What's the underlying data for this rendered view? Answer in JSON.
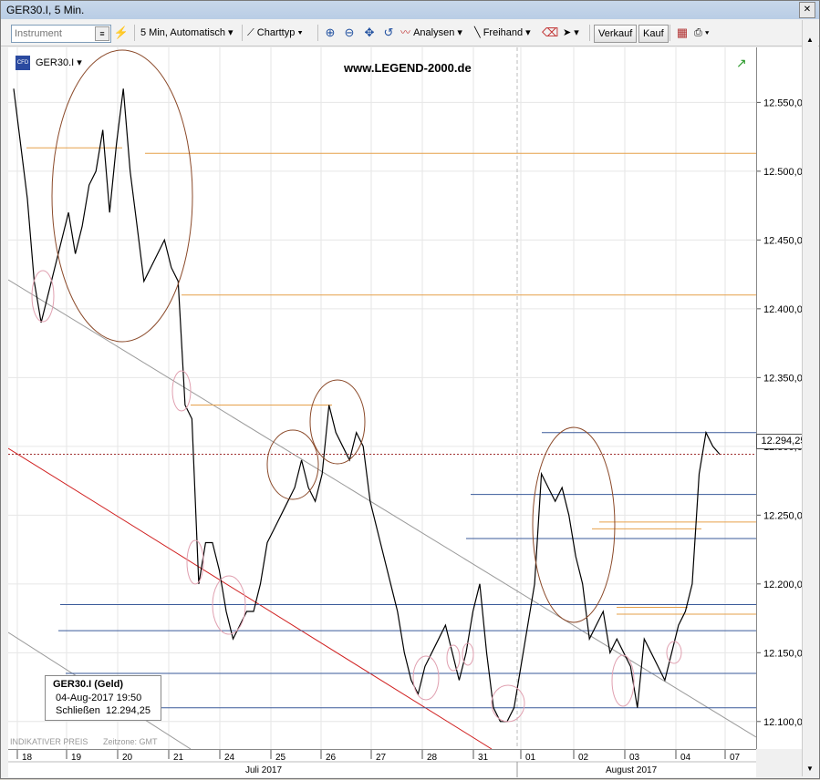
{
  "window": {
    "title": "GER30.I, 5 Min."
  },
  "toolbar": {
    "instrument_placeholder": "Instrument",
    "interval_label": "5 Min,  Automatisch",
    "charttype_label": "Charttyp",
    "analysen_label": "Analysen",
    "freihand_label": "Freihand",
    "verkauf_label": "Verkauf",
    "kauf_label": "Kauf"
  },
  "chart": {
    "symbol_label": "GER30.I",
    "watermark": "www.LEGEND-2000.de",
    "footer_left": "INDIKATIVER PREIS",
    "timezone": "Zeitzone: GMT",
    "price_tag": "12.294,25"
  },
  "info_box": {
    "title": "GER30.I (Geld)",
    "datetime": "04-Aug-2017 19:50",
    "close_label": "Schließen",
    "close_value": "12.294,25"
  },
  "colors": {
    "price_line": "#000000",
    "orange_lines": "#e6a04a",
    "blue_lines": "#3a5a9a",
    "red_trend": "#d02020",
    "gray_trend": "#9a9a9a",
    "brown_circles": "#8b4a2a",
    "pink_circles": "#e0a0b0"
  },
  "chart_data": {
    "type": "line",
    "title": "GER30.I, 5 Min.",
    "y_ticks": [
      "12.100,00",
      "12.150,00",
      "12.200,00",
      "12.250,00",
      "12.300,00",
      "12.350,00",
      "12.400,00",
      "12.450,00",
      "12.500,00",
      "12.550,00"
    ],
    "ylim": [
      12080,
      12590
    ],
    "x_ticks": [
      "18",
      "19",
      "20",
      "21",
      "24",
      "25",
      "26",
      "27",
      "28",
      "31",
      "01",
      "02",
      "03",
      "04",
      "07"
    ],
    "x_months": [
      "Juli 2017",
      "August 2017"
    ],
    "series": [
      {
        "values": [
          12560,
          12520,
          12480,
          12420,
          12390,
          12410,
          12430,
          12450,
          12470,
          12440,
          12460,
          12490,
          12500,
          12530,
          12470,
          12520,
          12560,
          12500,
          12460,
          12420,
          12430,
          12440,
          12450,
          12430,
          12420,
          12330,
          12320,
          12200,
          12230,
          12230,
          12210,
          12180,
          12160,
          12170,
          12180,
          12180,
          12200,
          12230,
          12240,
          12250,
          12260,
          12270,
          12290,
          12270,
          12260,
          12280,
          12330,
          12310,
          12300,
          12290,
          12310,
          12300,
          12260,
          12240,
          12220,
          12200,
          12180,
          12150,
          12130,
          12120,
          12140,
          12150,
          12160,
          12170,
          12150,
          12130,
          12150,
          12180,
          12200,
          12150,
          12110,
          12100,
          12100,
          12110,
          12140,
          12170,
          12200,
          12280,
          12270,
          12260,
          12270,
          12250,
          12220,
          12200,
          12160,
          12170,
          12180,
          12150,
          12160,
          12150,
          12140,
          12110,
          12160,
          12150,
          12140,
          12130,
          12150,
          12170,
          12180,
          12200,
          12280,
          12310,
          12300,
          12294.25
        ]
      }
    ],
    "horizontal_lines": {
      "orange": [
        12513,
        12410,
        12330,
        12245,
        12240,
        12178,
        12183,
        12517
      ],
      "blue": [
        12310,
        12265,
        12233,
        12185,
        12166,
        12135,
        12130,
        12110
      ]
    },
    "last_value": 12294.25,
    "grid": true
  }
}
